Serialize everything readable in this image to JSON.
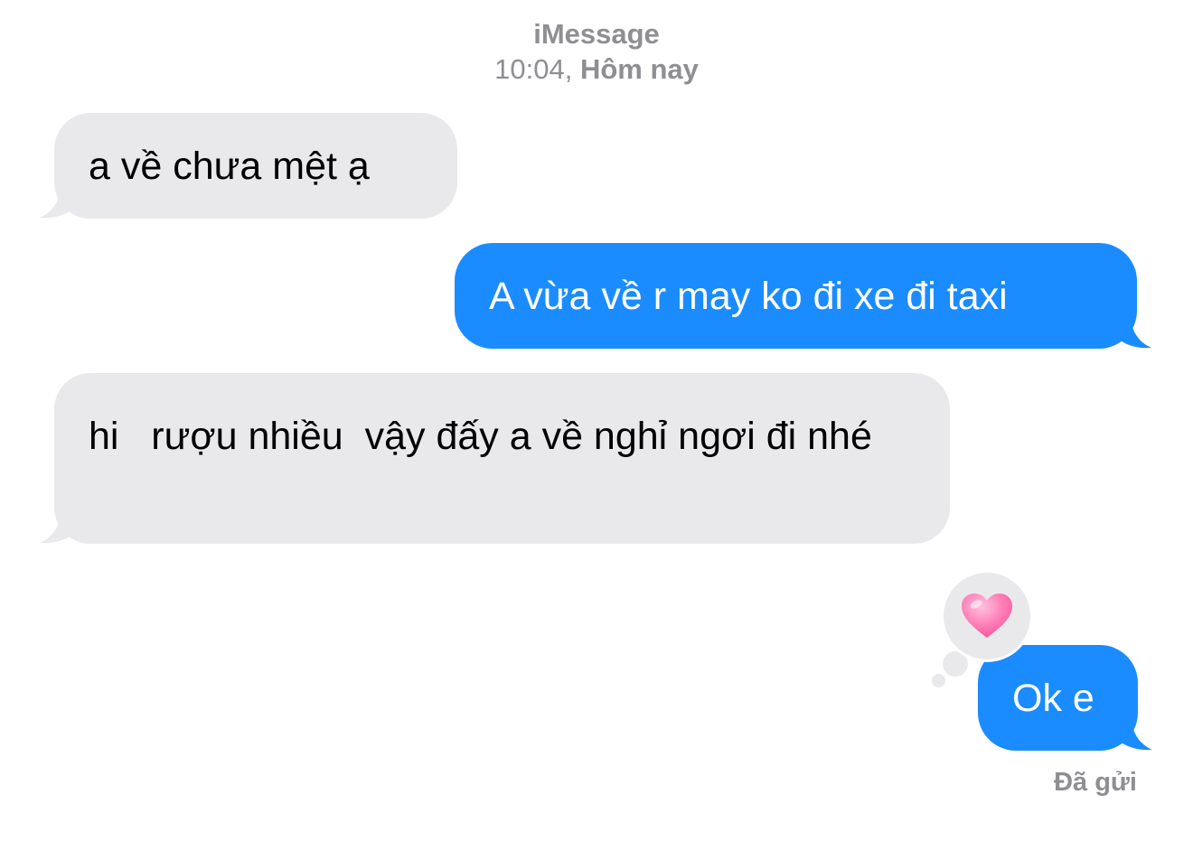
{
  "header": {
    "service": "iMessage",
    "time": "10:04,",
    "day": "Hôm nay"
  },
  "messages": [
    {
      "direction": "received",
      "text": "a về chưa mệt ạ"
    },
    {
      "direction": "sent",
      "text": "A vừa về r may ko đi xe đi taxi"
    },
    {
      "direction": "received",
      "text": "hi   rượu nhiều  vậy đấy a về nghỉ ngơi đi nhé"
    },
    {
      "direction": "sent",
      "text": "Ok e",
      "reaction": "heart-icon"
    }
  ],
  "status": "Đã gửi",
  "colors": {
    "sent_bubble": "#1a8cff",
    "received_bubble": "#e9e9eb",
    "meta_text": "#8e8e93",
    "heart": "#ff6fae"
  }
}
